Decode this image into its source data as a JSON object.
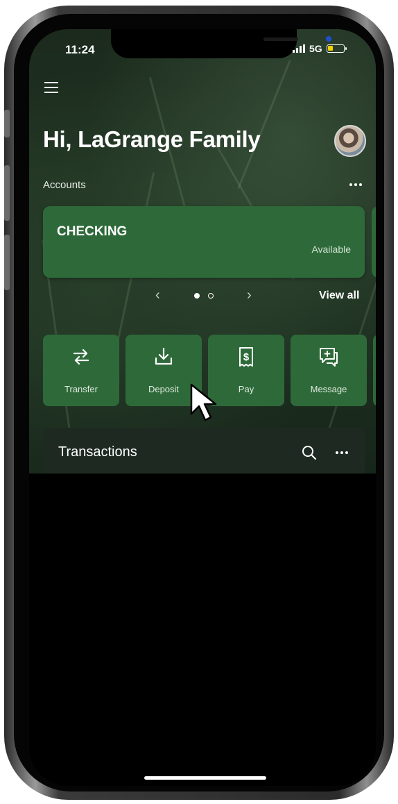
{
  "status_bar": {
    "time": "11:24",
    "network": "5G"
  },
  "header": {
    "greeting": "Hi, LaGrange Family"
  },
  "accounts": {
    "label": "Accounts",
    "cards": [
      {
        "name": "CHECKING",
        "available_label": "Available"
      }
    ],
    "pager": {
      "active_index": 0,
      "total": 2,
      "prev_glyph": "‹",
      "next_glyph": "›"
    },
    "view_all_label": "View all"
  },
  "actions": [
    {
      "label": "Transfer",
      "icon": "transfer-icon"
    },
    {
      "label": "Deposit",
      "icon": "deposit-icon"
    },
    {
      "label": "Pay",
      "icon": "pay-icon"
    },
    {
      "label": "Message",
      "icon": "message-icon"
    }
  ],
  "transactions": {
    "title": "Transactions"
  },
  "colors": {
    "accent_green": "#2e6a39",
    "background": "#1c2e1f",
    "battery": "#f2d100",
    "camera": "#1e4fd1"
  }
}
